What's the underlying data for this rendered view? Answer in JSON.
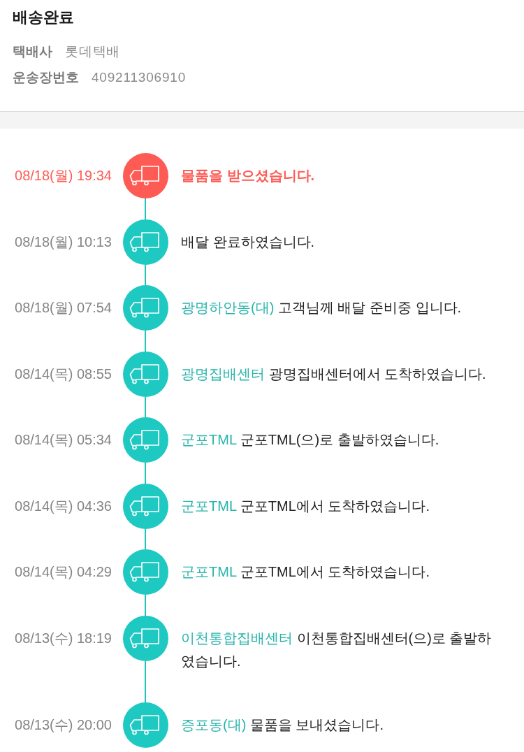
{
  "delivery": {
    "status_title": "배송완료",
    "details": [
      {
        "label": "택배사",
        "value": "롯데택배"
      },
      {
        "label": "운송장번호",
        "value": "409211306910"
      }
    ]
  },
  "events": [
    {
      "time": "08/18(월) 19:34",
      "current": true,
      "message": "물품을 받으셨습니다."
    },
    {
      "time": "08/18(월) 10:13",
      "current": false,
      "message": "배달 완료하였습니다."
    },
    {
      "time": "08/18(월) 07:54",
      "current": false,
      "location": "광명하안동(대)",
      "message": "고객님께 배달 준비중 입니다."
    },
    {
      "time": "08/14(목) 08:55",
      "current": false,
      "location": "광명집배센터",
      "message": "광명집배센터에서 도착하였습니다."
    },
    {
      "time": "08/14(목) 05:34",
      "current": false,
      "location": "군포TML",
      "message": "군포TML(으)로 출발하였습니다."
    },
    {
      "time": "08/14(목) 04:36",
      "current": false,
      "location": "군포TML",
      "message": "군포TML에서 도착하였습니다."
    },
    {
      "time": "08/14(목) 04:29",
      "current": false,
      "location": "군포TML",
      "message": "군포TML에서 도착하였습니다."
    },
    {
      "time": "08/13(수) 18:19",
      "current": false,
      "location": "이천통합집배센터",
      "message": "이천통합집배센터(으)로 출발하였습니다."
    },
    {
      "time": "08/13(수) 20:00",
      "current": false,
      "location": "증포동(대)",
      "message": "물품을 보내셨습니다."
    }
  ]
}
